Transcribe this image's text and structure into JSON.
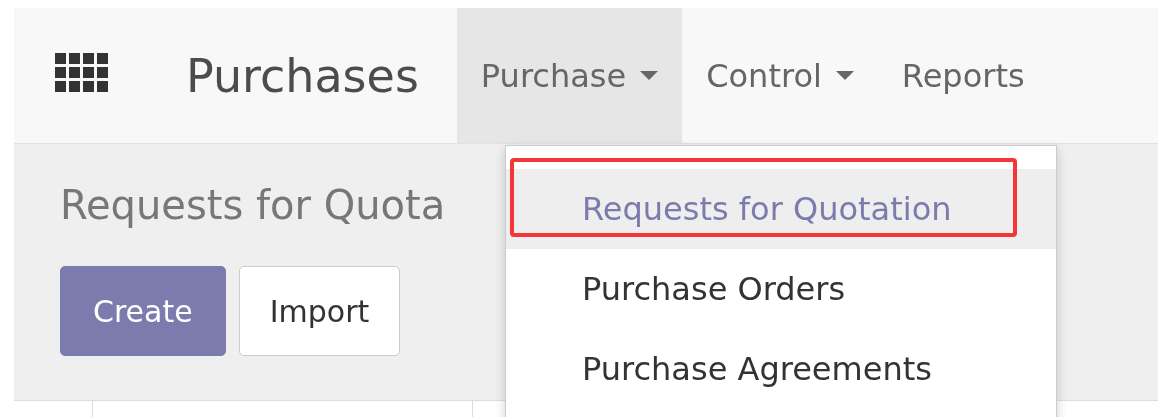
{
  "navbar": {
    "brand": "Purchases",
    "menus": [
      {
        "label": "Purchase",
        "selected": true,
        "has_caret": true
      },
      {
        "label": "Control",
        "selected": false,
        "has_caret": true
      },
      {
        "label": "Reports",
        "selected": false,
        "has_caret": false
      }
    ]
  },
  "page": {
    "title": "Requests for Quota",
    "buttons": [
      {
        "label": "Create",
        "kind": "primary"
      },
      {
        "label": "Import",
        "kind": "secondary"
      }
    ]
  },
  "dropdown": {
    "items": [
      {
        "label": "Requests for Quotation",
        "selected": true,
        "highlighted_frame": true
      },
      {
        "label": "Purchase Orders",
        "selected": false,
        "highlighted_frame": false
      },
      {
        "label": "Purchase Agreements",
        "selected": false,
        "highlighted_frame": false
      }
    ]
  }
}
